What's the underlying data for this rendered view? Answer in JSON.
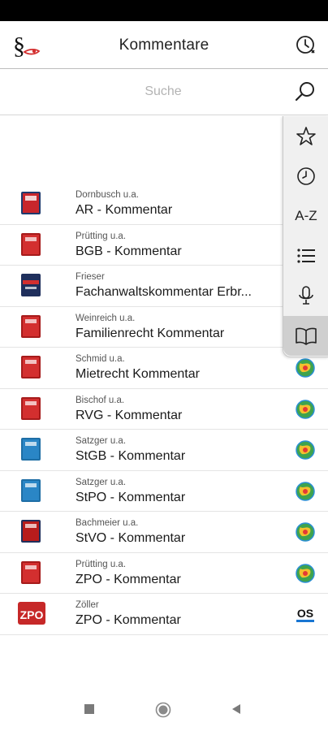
{
  "header": {
    "title": "Kommentare",
    "logo_icon": "paragraph-logo-icon",
    "history_icon": "clock-history-icon"
  },
  "search": {
    "placeholder": "Suche",
    "value": "",
    "icon": "search-icon"
  },
  "side_menu": {
    "items": [
      {
        "name": "favorites",
        "icon": "star-icon"
      },
      {
        "name": "history",
        "icon": "clock-icon"
      },
      {
        "name": "alphabetical",
        "label": "A-Z"
      },
      {
        "name": "list",
        "icon": "list-icon"
      },
      {
        "name": "voice",
        "icon": "microphone-icon"
      },
      {
        "name": "books",
        "icon": "open-book-icon",
        "active": true
      }
    ]
  },
  "items": [
    {
      "author": "Dornbusch u.a.",
      "title": "AR - Kommentar",
      "cover_color": "#c8262c",
      "badge": "none"
    },
    {
      "author": "Prütting u.a.",
      "title": "BGB - Kommentar",
      "cover_color": "#d32f2f",
      "badge": "none"
    },
    {
      "author": "Frieser",
      "title": "Fachanwaltskommentar Erbr...",
      "cover_color": "#1f2f5c",
      "badge": "none"
    },
    {
      "author": "Weinreich u.a.",
      "title": "Familienrecht Kommentar",
      "cover_color": "#d32f2f",
      "badge": "none"
    },
    {
      "author": "Schmid u.a.",
      "title": "Mietrecht Kommentar",
      "cover_color": "#d32f2f",
      "badge": "globe"
    },
    {
      "author": "Bischof u.a.",
      "title": "RVG - Kommentar",
      "cover_color": "#d32f2f",
      "badge": "globe"
    },
    {
      "author": "Satzger u.a.",
      "title": "StGB - Kommentar",
      "cover_color": "#2a86c6",
      "badge": "globe"
    },
    {
      "author": "Satzger u.a.",
      "title": "StPO - Kommentar",
      "cover_color": "#2a86c6",
      "badge": "globe"
    },
    {
      "author": "Bachmeier u.a.",
      "title": "StVO - Kommentar",
      "cover_color": "#b71c1c",
      "badge": "globe"
    },
    {
      "author": "Prütting u.a.",
      "title": "ZPO - Kommentar",
      "cover_color": "#d32f2f",
      "badge": "globe"
    },
    {
      "author": "Zöller",
      "title": "ZPO - Kommentar",
      "cover_color": "#c62828",
      "cover_text": "ZPO",
      "badge": "os",
      "badge_text": "OS"
    }
  ],
  "nav": {
    "items": [
      "recents-square-icon",
      "home-circle-icon",
      "back-triangle-icon"
    ]
  }
}
